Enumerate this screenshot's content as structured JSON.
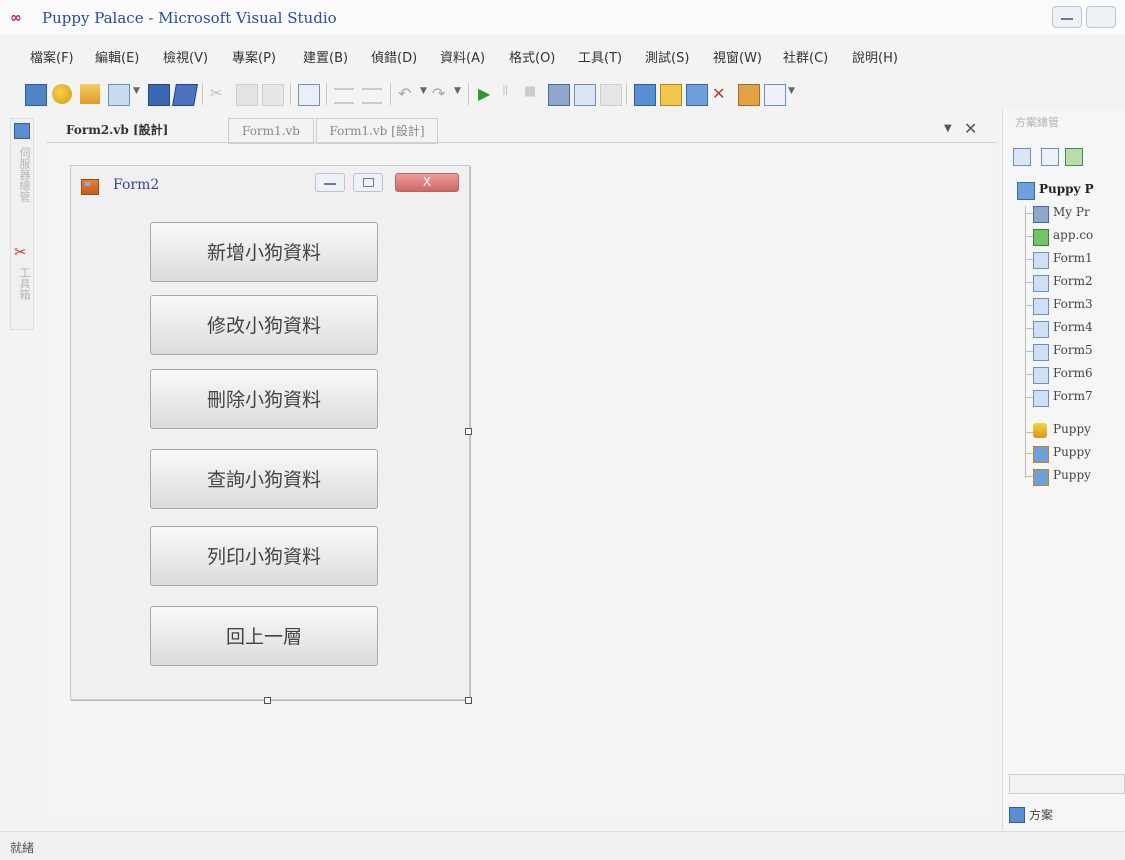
{
  "window": {
    "title": "Puppy Palace - Microsoft Visual Studio"
  },
  "menu": [
    "檔案(F)",
    "編輯(E)",
    "檢視(V)",
    "專案(P)",
    "建置(B)",
    "偵錯(D)",
    "資料(A)",
    "格式(O)",
    "工具(T)",
    "測試(S)",
    "視窗(W)",
    "社群(C)",
    "說明(H)"
  ],
  "toolbar": {
    "icons": [
      "add-project-icon",
      "new-item-icon",
      "open-file-icon",
      "add-item-icon",
      "save-icon",
      "save-all-icon",
      "cut-icon",
      "copy-icon",
      "paste-icon",
      "find-icon",
      "comment-icon",
      "uncomment-icon",
      "undo-icon",
      "redo-icon",
      "start-debug-icon",
      "pause-icon",
      "stop-icon",
      "toolbox-icon",
      "properties-icon",
      "object-browser-icon",
      "solution-explorer-icon",
      "class-view-icon",
      "start-page-icon",
      "tools-icon",
      "extensions-icon",
      "window-icon"
    ]
  },
  "left_dock": {
    "server_explorer_label": "伺服器總管",
    "toolbox_label": "工具箱"
  },
  "tabs": {
    "active": "Form2.vb [設計]",
    "items": [
      "Form1.vb",
      "Form1.vb [設計]"
    ]
  },
  "form2": {
    "title": "Form2",
    "close_glyph": "X",
    "buttons": [
      "新增小狗資料",
      "修改小狗資料",
      "刪除小狗資料",
      "查詢小狗資料",
      "列印小狗資料",
      "回上一層"
    ]
  },
  "solution_explorer": {
    "title": "方案總管",
    "project": "Puppy P",
    "items": [
      "My Pr",
      "app.co",
      "Form1",
      "Form2",
      "Form3",
      "Form4",
      "Form5",
      "Form6",
      "Form7",
      "Puppy",
      "Puppy",
      "Puppy"
    ],
    "tab_label": "方案"
  },
  "status": {
    "text": "就緒"
  },
  "colors": {
    "title_text": "#2b4aa0",
    "close_button": "#d36666",
    "button_face": "#e8e8e8"
  }
}
